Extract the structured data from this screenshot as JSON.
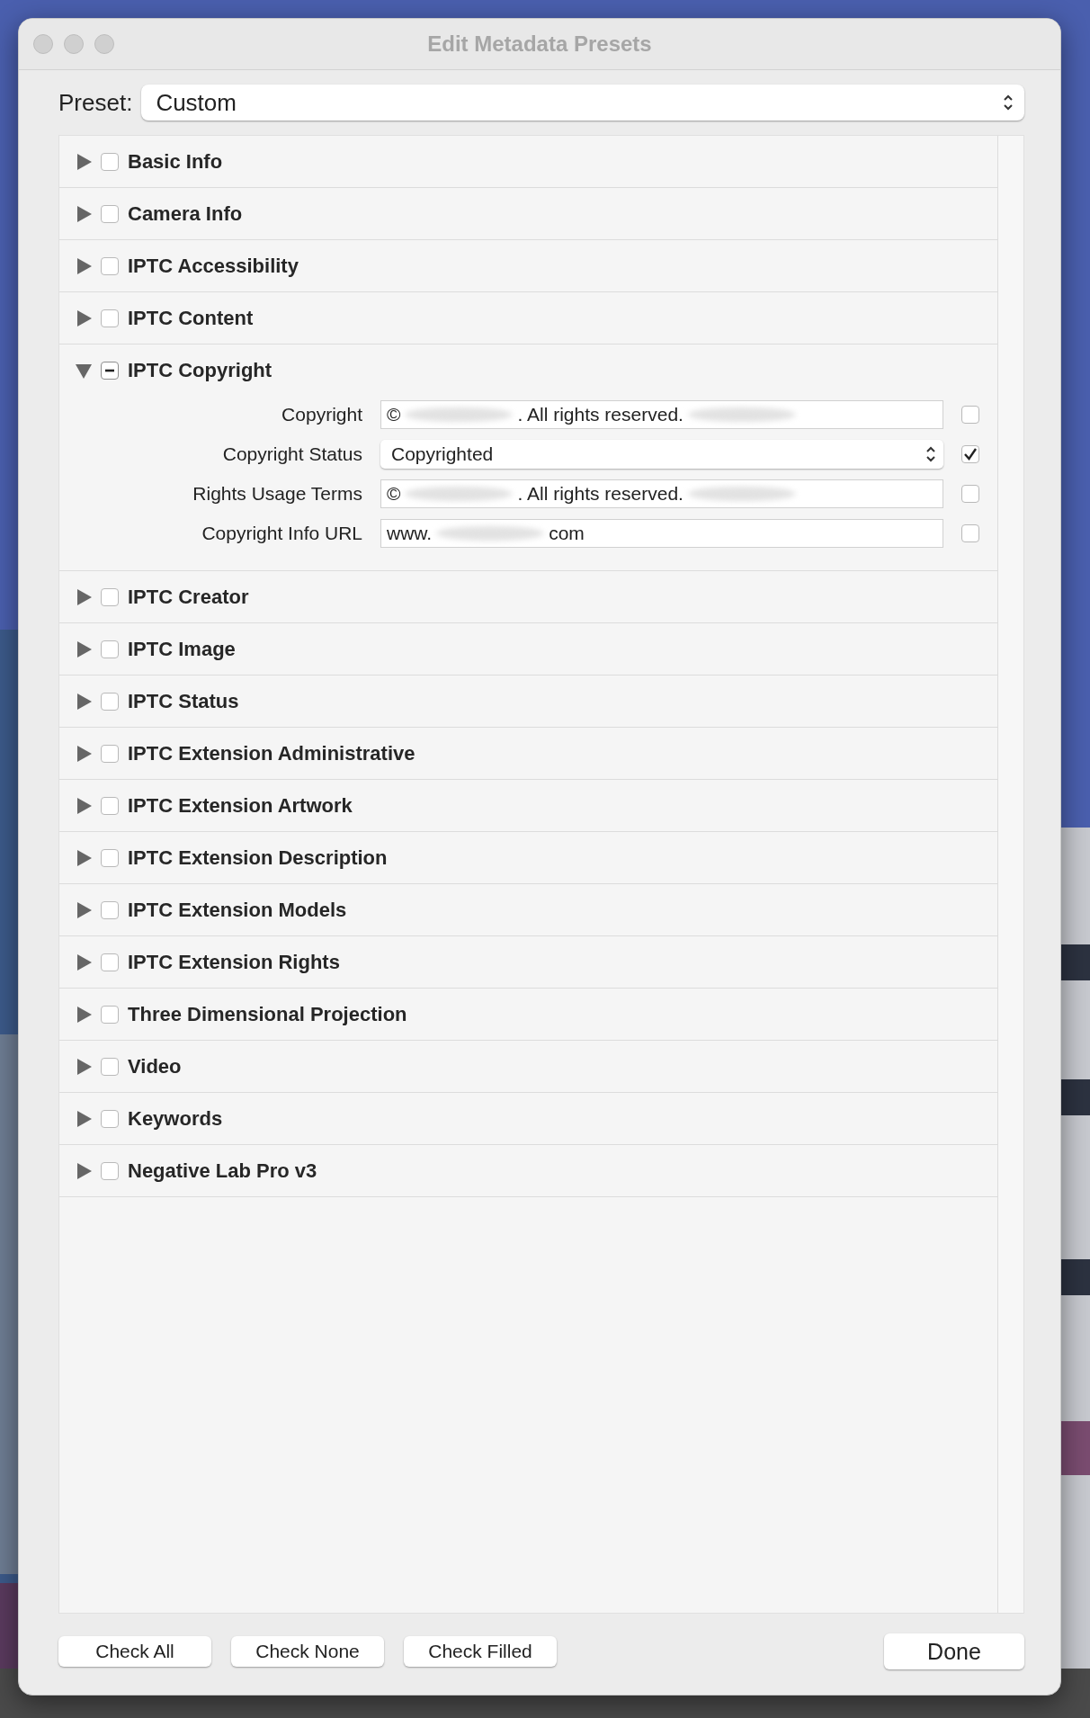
{
  "window": {
    "title": "Edit Metadata Presets"
  },
  "preset": {
    "label": "Preset:",
    "value": "Custom"
  },
  "sections": [
    {
      "label": "Basic Info",
      "expanded": false,
      "checked": false,
      "mixed": false
    },
    {
      "label": "Camera Info",
      "expanded": false,
      "checked": false,
      "mixed": false
    },
    {
      "label": "IPTC Accessibility",
      "expanded": false,
      "checked": false,
      "mixed": false
    },
    {
      "label": "IPTC Content",
      "expanded": false,
      "checked": false,
      "mixed": false
    },
    {
      "label": "IPTC Copyright",
      "expanded": true,
      "checked": true,
      "mixed": true,
      "fields": [
        {
          "label": "Copyright",
          "kind": "text",
          "checked": false,
          "segments": [
            {
              "kind": "text",
              "text": "©"
            },
            {
              "kind": "redacted"
            },
            {
              "kind": "text",
              "text": ". All rights reserved."
            },
            {
              "kind": "redacted"
            }
          ]
        },
        {
          "label": "Copyright Status",
          "kind": "select",
          "checked": true,
          "segments": [
            {
              "kind": "text",
              "text": "Copyrighted"
            }
          ]
        },
        {
          "label": "Rights Usage Terms",
          "kind": "text",
          "checked": false,
          "segments": [
            {
              "kind": "text",
              "text": "©"
            },
            {
              "kind": "redacted"
            },
            {
              "kind": "text",
              "text": ". All rights reserved."
            },
            {
              "kind": "redacted"
            }
          ]
        },
        {
          "label": "Copyright Info URL",
          "kind": "text",
          "checked": false,
          "segments": [
            {
              "kind": "text",
              "text": "www."
            },
            {
              "kind": "redacted"
            },
            {
              "kind": "text",
              "text": "com"
            }
          ]
        }
      ]
    },
    {
      "label": "IPTC Creator",
      "expanded": false,
      "checked": false,
      "mixed": false
    },
    {
      "label": "IPTC Image",
      "expanded": false,
      "checked": false,
      "mixed": false
    },
    {
      "label": "IPTC Status",
      "expanded": false,
      "checked": false,
      "mixed": false
    },
    {
      "label": "IPTC Extension Administrative",
      "expanded": false,
      "checked": false,
      "mixed": false
    },
    {
      "label": "IPTC Extension Artwork",
      "expanded": false,
      "checked": false,
      "mixed": false
    },
    {
      "label": "IPTC Extension Description",
      "expanded": false,
      "checked": false,
      "mixed": false
    },
    {
      "label": "IPTC Extension Models",
      "expanded": false,
      "checked": false,
      "mixed": false
    },
    {
      "label": "IPTC Extension Rights",
      "expanded": false,
      "checked": false,
      "mixed": false
    },
    {
      "label": "Three Dimensional Projection",
      "expanded": false,
      "checked": false,
      "mixed": false
    },
    {
      "label": "Video",
      "expanded": false,
      "checked": false,
      "mixed": false
    },
    {
      "label": "Keywords",
      "expanded": false,
      "checked": false,
      "mixed": false
    },
    {
      "label": "Negative Lab Pro v3",
      "expanded": false,
      "checked": false,
      "mixed": false
    }
  ],
  "buttons": [
    "Check All",
    "Check None",
    "Check Filled"
  ],
  "done": "Done"
}
